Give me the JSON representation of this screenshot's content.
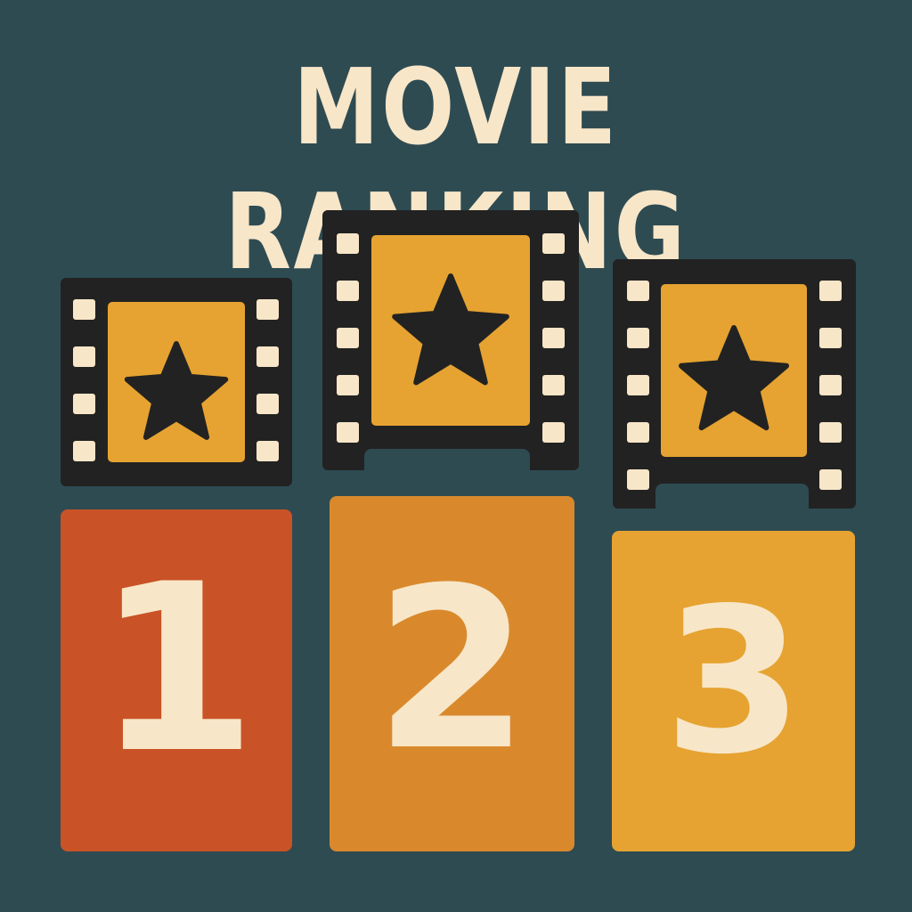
{
  "title": "MOVIE RANKING",
  "colors": {
    "background": "#2e4b52",
    "text": "#f8e6c8",
    "film_strip": "#222222",
    "film_frame": "#e6a331",
    "star": "#222222",
    "rank_1": "#c95326",
    "rank_2": "#d9892c",
    "rank_3": "#e6a331"
  },
  "films": [
    {
      "icon": "film-strip-star-icon"
    },
    {
      "icon": "film-strip-star-icon"
    },
    {
      "icon": "film-strip-star-icon"
    }
  ],
  "ranks": [
    {
      "label": "1",
      "color": "#c95326"
    },
    {
      "label": "2",
      "color": "#d9892c"
    },
    {
      "label": "3",
      "color": "#e6a331"
    }
  ]
}
